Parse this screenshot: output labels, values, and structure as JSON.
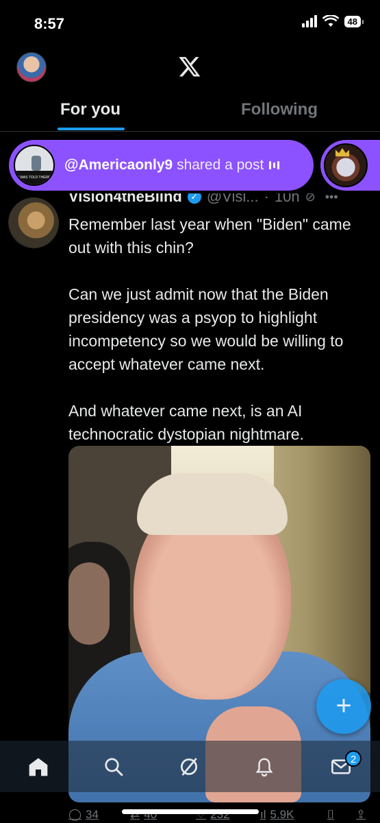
{
  "status_bar": {
    "time": "8:57",
    "battery": "48"
  },
  "header": {
    "logo": "x-logo"
  },
  "tabs": [
    {
      "label": "For you",
      "active": true
    },
    {
      "label": "Following",
      "active": false
    }
  ],
  "space": {
    "host": "@Americaonly9",
    "action": "shared a post",
    "thumb_caption": "I WAS TOLD THERE WOULD BE PEACE"
  },
  "tweet": {
    "author_name": "Vision4theBlind",
    "handle": "@Visi...",
    "dot": "·",
    "time": "10h",
    "paragraphs": [
      "Remember last year when \"Biden\" came out with this chin?",
      "Can we just admit now that the Biden presidency was a psyop to highlight incompetency so we would be willing to accept whatever came next.",
      "And whatever came next, is an AI technocratic dystopian nightmare."
    ],
    "actions": {
      "replies": "34",
      "reposts": "40",
      "likes": "232",
      "views": "5.9K"
    }
  },
  "compose_label": "+",
  "nav": {
    "items": [
      "home-icon",
      "search-icon",
      "grok-icon",
      "notifications-icon",
      "messages-icon"
    ],
    "messages_badge": "2"
  },
  "colors": {
    "accent": "#1d9bf0",
    "space_purple": "#8c52ff",
    "muted": "#71767b"
  }
}
